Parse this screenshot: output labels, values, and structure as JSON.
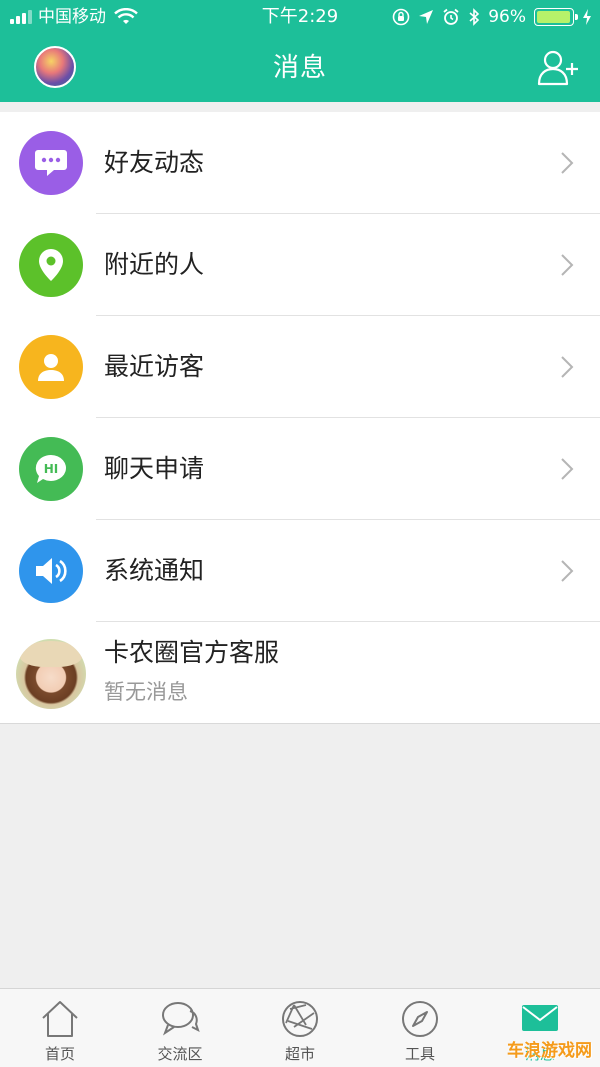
{
  "status_bar": {
    "carrier": "中国移动",
    "time": "下午2:29",
    "battery": "96%",
    "battery_level": 0.96
  },
  "header": {
    "title": "消息"
  },
  "list": {
    "items": [
      {
        "label": "好友动态",
        "icon": "chat-bubble-icon",
        "color": "#9a5ee6"
      },
      {
        "label": "附近的人",
        "icon": "location-pin-icon",
        "color": "#5cc12a"
      },
      {
        "label": "最近访客",
        "icon": "person-icon",
        "color": "#f7b51e"
      },
      {
        "label": "聊天申请",
        "icon": "hi-bubble-icon",
        "color": "#44bb55",
        "icon_text": "HI"
      },
      {
        "label": "系统通知",
        "icon": "speaker-icon",
        "color": "#2f95ec"
      }
    ],
    "service": {
      "name": "卡农圈官方客服",
      "subtitle": "暂无消息"
    }
  },
  "tabbar": {
    "tabs": [
      {
        "label": "首页",
        "icon": "home-icon"
      },
      {
        "label": "交流区",
        "icon": "chat-icon"
      },
      {
        "label": "超市",
        "icon": "aperture-icon"
      },
      {
        "label": "工具",
        "icon": "compass-icon"
      },
      {
        "label": "消息",
        "icon": "mail-icon",
        "active": true
      }
    ]
  },
  "watermark": "车浪游戏网",
  "colors": {
    "primary": "#1dbf99"
  }
}
